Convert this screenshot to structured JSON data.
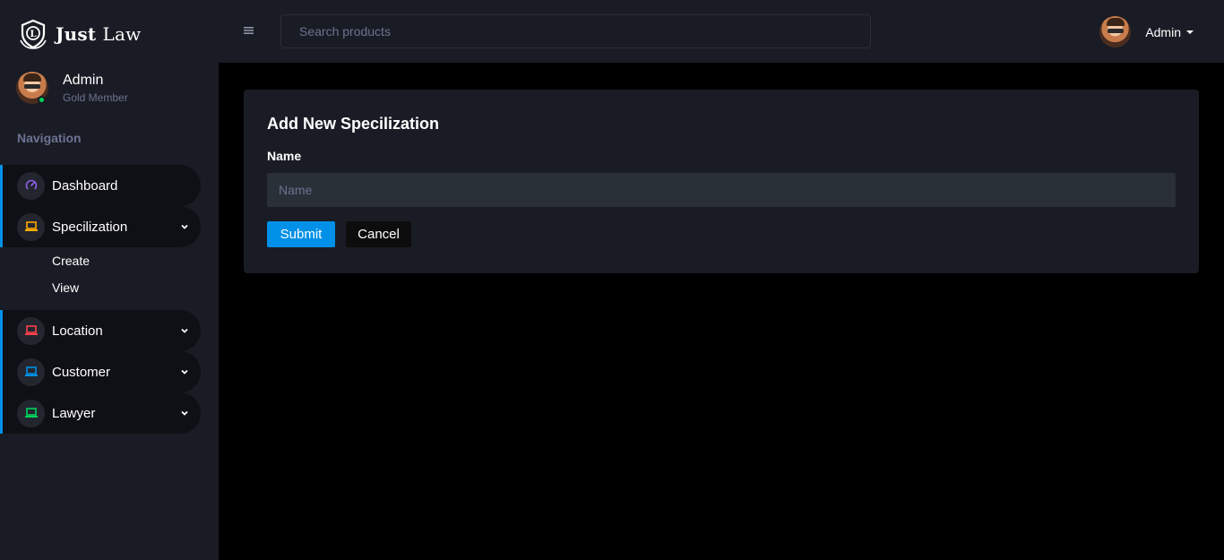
{
  "brand": {
    "name_bold": "Just",
    "name_light": "Law"
  },
  "profile": {
    "name": "Admin",
    "role": "Gold Member"
  },
  "nav": {
    "heading": "Navigation",
    "items": [
      {
        "label": "Dashboard",
        "icon": "speedometer-icon",
        "color": "#8f5fe8"
      },
      {
        "label": "Specilization",
        "icon": "laptop-icon",
        "color": "#ffab00"
      },
      {
        "label": "Location",
        "icon": "laptop-icon",
        "color": "#fc424a"
      },
      {
        "label": "Customer",
        "icon": "laptop-icon",
        "color": "#0090e7"
      },
      {
        "label": "Lawyer",
        "icon": "laptop-icon",
        "color": "#00d25b"
      }
    ],
    "sub_items": [
      "Create",
      "View"
    ]
  },
  "topbar": {
    "search_placeholder": "Search products",
    "user_name": "Admin"
  },
  "form": {
    "title": "Add New Specilization",
    "name_label": "Name",
    "name_placeholder": "Name",
    "submit_label": "Submit",
    "cancel_label": "Cancel"
  }
}
